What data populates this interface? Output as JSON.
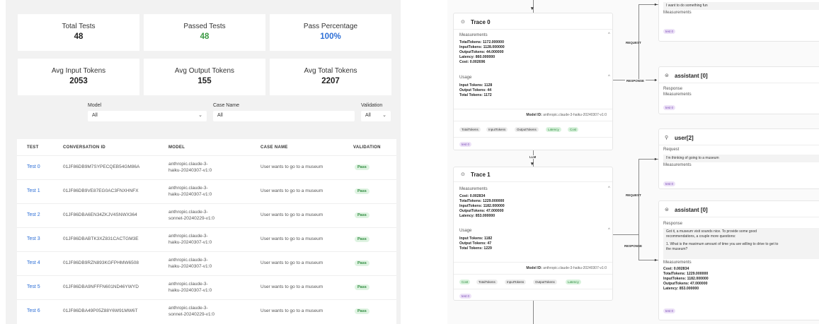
{
  "stats": {
    "total_tests_label": "Total Tests",
    "total_tests_value": "48",
    "passed_tests_label": "Passed Tests",
    "passed_tests_value": "48",
    "pass_pct_label": "Pass Percentage",
    "pass_pct_value": "100%",
    "avg_input_label": "Avg Input Tokens",
    "avg_input_value": "2053",
    "avg_output_label": "Avg Output Tokens",
    "avg_output_value": "155",
    "avg_total_label": "Avg Total Tokens",
    "avg_total_value": "2207"
  },
  "filters": {
    "model_label": "Model",
    "model_value": "All",
    "case_label": "Case Name",
    "case_value": "All",
    "validation_label": "Validation",
    "validation_value": "All"
  },
  "table": {
    "headers": [
      "TEST",
      "CONVERSATION ID",
      "MODEL",
      "CASE NAME",
      "VALIDATION"
    ],
    "rows": [
      {
        "test": "Test 0",
        "conv": "01JF86DB9M7SYPECQEB54GM86A",
        "model1": "anthropic.claude-3-",
        "model2": "haiku-20240307-v1:0",
        "case": "User wants to go to a museum",
        "valid": "Pass"
      },
      {
        "test": "Test 1",
        "conv": "01JF86DB9VE87EG0AC3FNXHNFX",
        "model1": "anthropic.claude-3-",
        "model2": "haiku-20240307-v1:0",
        "case": "User wants to go to a museum",
        "valid": "Pass"
      },
      {
        "test": "Test 2",
        "conv": "01JF86DBA6EN34ZKJV4SNWX364",
        "model1": "anthropic.claude-3-",
        "model2": "sonnet-20240229-v1:0",
        "case": "User wants to go to a museum",
        "valid": "Pass"
      },
      {
        "test": "Test 3",
        "conv": "01JF86DBABTK3XZ831CACTGM3E",
        "model1": "anthropic.claude-3-",
        "model2": "haiku-20240307-v1:0",
        "case": "User wants to go to a museum",
        "valid": "Pass"
      },
      {
        "test": "Test 4",
        "conv": "01JF86DB9RZN893KGFPHMW6508",
        "model1": "anthropic.claude-3-",
        "model2": "haiku-20240307-v1:0",
        "case": "User wants to go to a museum",
        "valid": "Pass"
      },
      {
        "test": "Test 5",
        "conv": "01JF86DBA9NFFFN601ND46YWYD",
        "model1": "anthropic.claude-3-",
        "model2": "haiku-20240307-v1:0",
        "case": "User wants to go to a museum",
        "valid": "Pass"
      },
      {
        "test": "Test 6",
        "conv": "01JF86DBA49P05Z88Y6W91MW6T",
        "model1": "anthropic.claude-3-",
        "model2": "sonnet-20240229-v1:0",
        "case": "User wants to go to a museum",
        "valid": "Pass"
      }
    ]
  },
  "trace0": {
    "title": "Trace 0",
    "measurements_label": "Measurements",
    "m": [
      "TotalTokens: 1172.000000",
      "InputTokens: 1128.000000",
      "OutputTokens: 44.000000",
      "Latency: 860.000000",
      "Cost: 0.002696"
    ],
    "usage_label": "Usage",
    "u": [
      "Input Tokens: 1128",
      "Output Tokens: 44",
      "Total Tokens: 1172"
    ],
    "model_id_label": "Model ID:",
    "model_id": "anthropic.claude-3-haiku-20240307-v1:0",
    "tags": [
      "TotalTokens",
      "InputTokens",
      "OutputTokens",
      "Latency",
      "Cost"
    ],
    "test_tag": "test 0"
  },
  "trace1": {
    "title": "Trace 1",
    "measurements_label": "Measurements",
    "m": [
      "Cost: 0.002834",
      "TotalTokens: 1229.000000",
      "InputTokens: 1182.000000",
      "OutputTokens: 47.000000",
      "Latency: 853.000000"
    ],
    "usage_label": "Usage",
    "u": [
      "Input Tokens: 1182",
      "Output Tokens: 47",
      "Total Tokens: 1229"
    ],
    "model_id_label": "Model ID:",
    "model_id": "anthropic.claude-3-haiku-20240307-v1:0",
    "tags": [
      "Cost",
      "TotalTokens",
      "InputTokens",
      "OutputTokens",
      "Latency"
    ],
    "test_tag": "test 0"
  },
  "edges": {
    "request": "REQUEST",
    "response": "RESPONSE",
    "llm": "LLM"
  },
  "top_card": {
    "text": "I want to do something fun",
    "measurements": "Measurements",
    "tag": "test 0"
  },
  "assistant0a": {
    "title": "assistant [0]",
    "response": "Response",
    "measurements": "Measurements",
    "tag": "test 0"
  },
  "user2": {
    "title": "user[2]",
    "request": "Request",
    "text": "I'm thinking of going to a museum",
    "measurements": "Measurements",
    "tag": "test 0"
  },
  "assistant0b": {
    "title": "assistant [0]",
    "response": "Response",
    "text1": "Got it, a museum visit sounds nice. To provide some good",
    "text2": "recommendations, a couple more questions:",
    "text3": "1. What is the maximum amount of time you are willing to drive to get to",
    "text4": "the museum?",
    "measurements": "Measurements",
    "m": [
      "Cost: 0.002834",
      "TotalTokens: 1229.000000",
      "InputTokens: 1182.000000",
      "OutputTokens: 47.000000",
      "Latency: 853.000000"
    ],
    "tag": "test 0"
  }
}
